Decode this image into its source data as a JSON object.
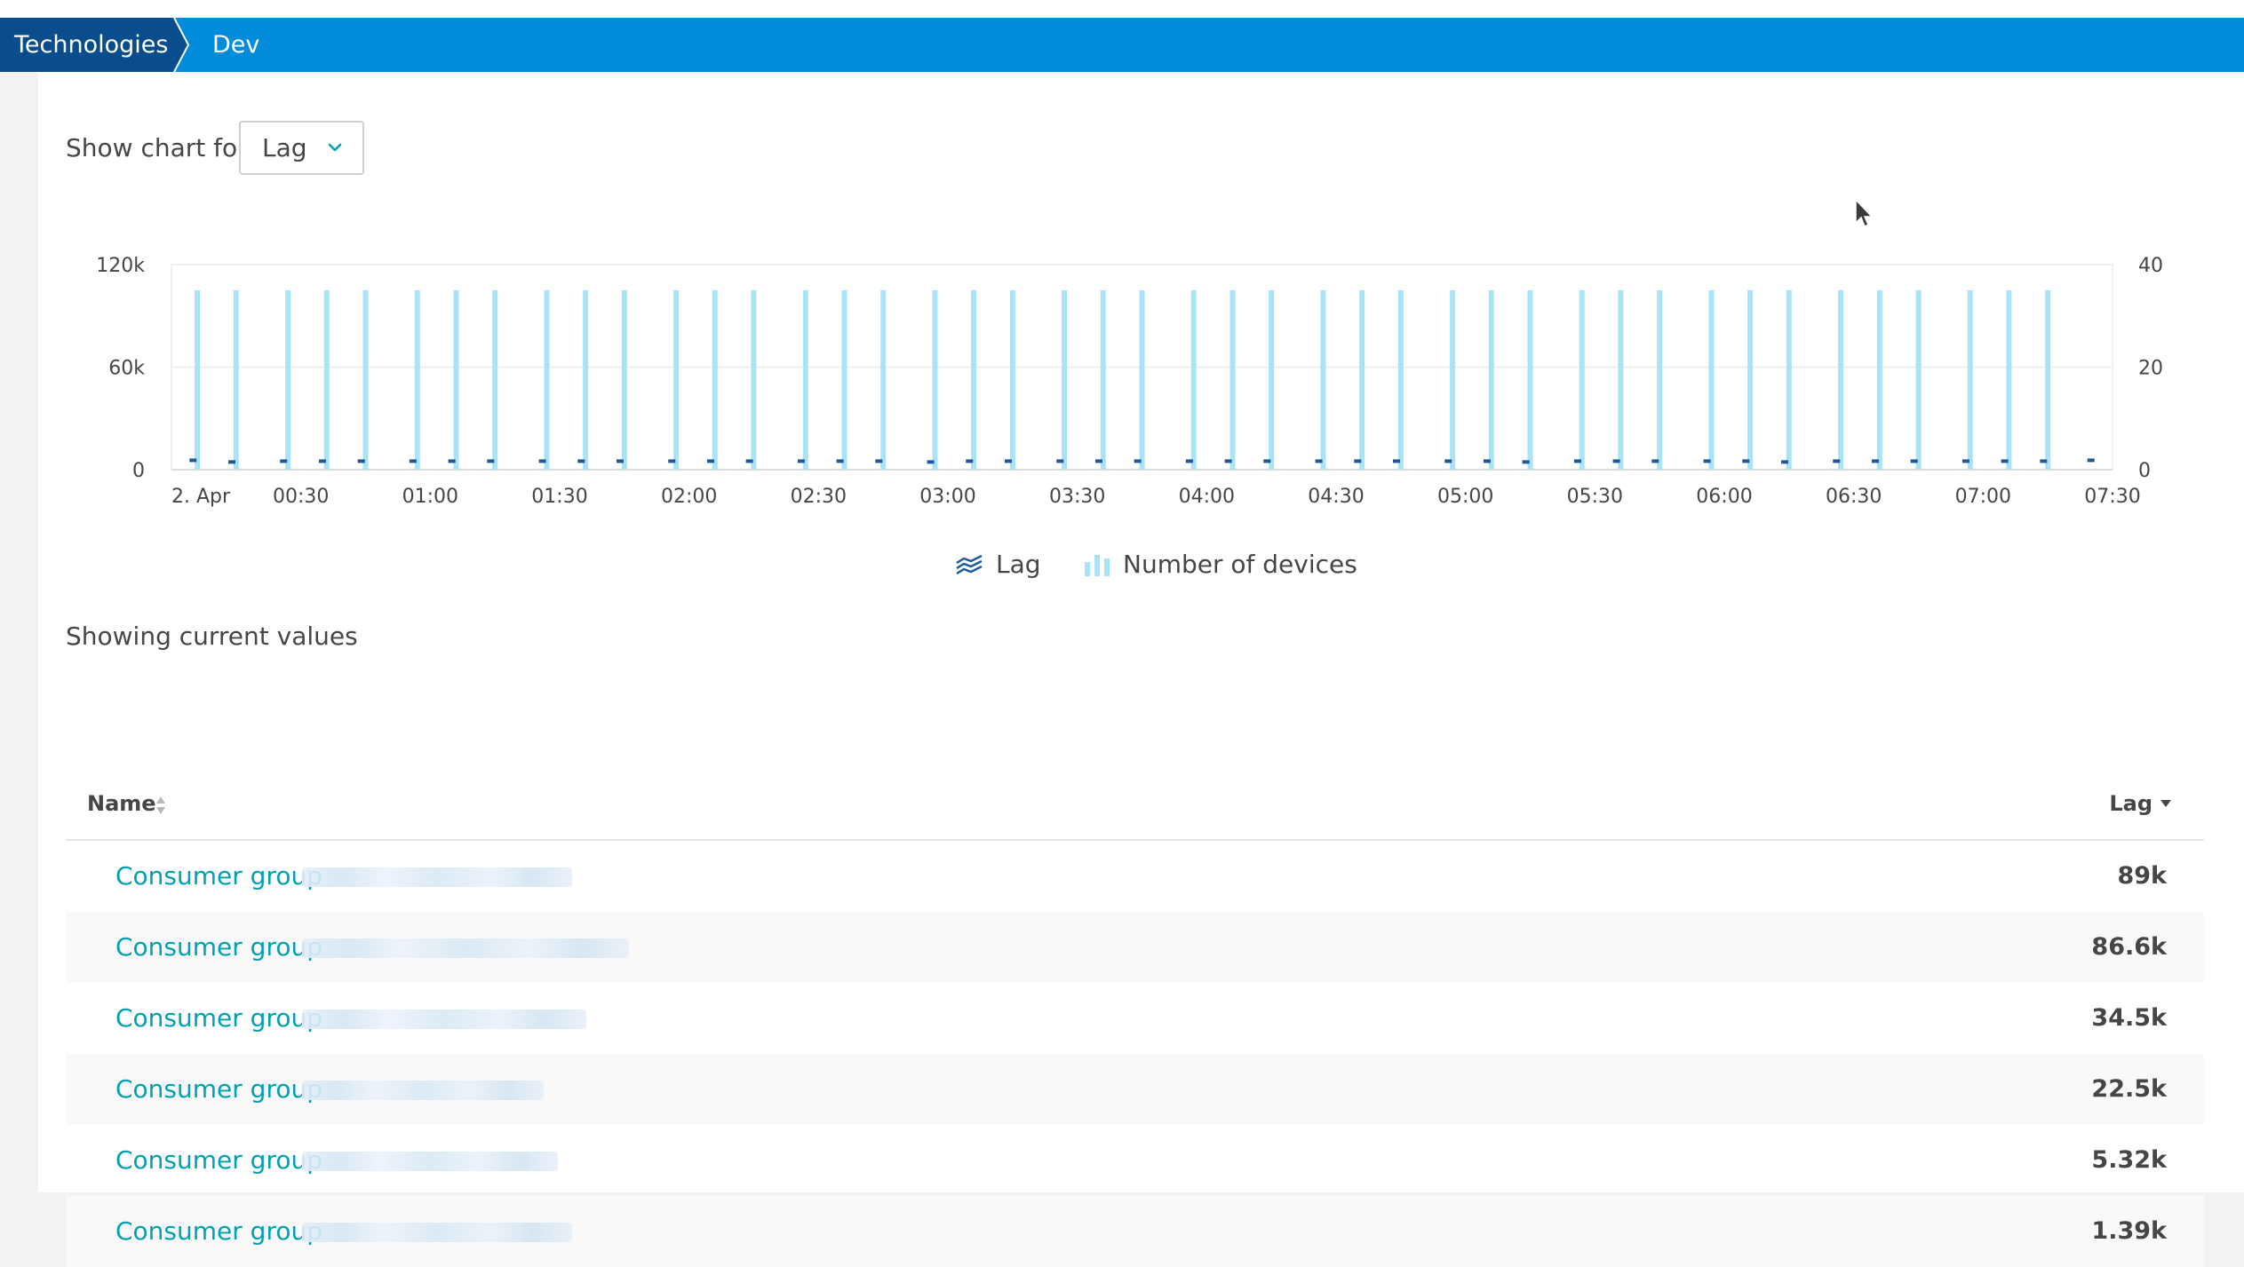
{
  "breadcrumb": {
    "items": [
      "Technologies",
      "Dev"
    ]
  },
  "colors": {
    "header": "#008cdb",
    "header_dark": "#0a4d8c",
    "link": "#00a1b2",
    "bar": "#a9e3f7",
    "lag": "#1e5a9a"
  },
  "controls": {
    "show_chart_for_label": "Show chart for",
    "metric_selected": "Lag"
  },
  "chart_data": {
    "type": "bar",
    "x_ticks": [
      "2. Apr",
      "00:30",
      "01:00",
      "01:30",
      "02:00",
      "02:30",
      "03:00",
      "03:30",
      "04:00",
      "04:30",
      "05:00",
      "05:30",
      "06:00",
      "06:30",
      "07:00",
      "07:30"
    ],
    "y_left_ticks": [
      "120k",
      "60k",
      "0"
    ],
    "y_right_ticks": [
      "40",
      "20",
      "0"
    ],
    "y_left_range": [
      0,
      120000
    ],
    "y_right_range": [
      0,
      40
    ],
    "grid": true,
    "legend_position": "bottom",
    "series": [
      {
        "name": "Number of devices",
        "axis": "right",
        "kind": "bar",
        "x_minutes": [
          6,
          15,
          27,
          36,
          45,
          57,
          66,
          75,
          87,
          96,
          105,
          117,
          126,
          135,
          147,
          156,
          165,
          177,
          186,
          195,
          207,
          216,
          225,
          237,
          246,
          255,
          267,
          276,
          285,
          297,
          306,
          315,
          327,
          336,
          345,
          357,
          366,
          375,
          387,
          396,
          405,
          417,
          426,
          435
        ],
        "values": [
          35,
          35,
          35,
          35,
          35,
          35,
          35,
          35,
          35,
          35,
          35,
          35,
          35,
          35,
          35,
          35,
          35,
          35,
          35,
          35,
          35,
          35,
          35,
          35,
          35,
          35,
          35,
          35,
          35,
          35,
          35,
          35,
          35,
          35,
          35,
          35,
          35,
          35,
          35,
          35,
          35,
          35,
          35,
          35
        ]
      },
      {
        "name": "Lag",
        "axis": "left",
        "kind": "marker",
        "x_minutes": [
          5,
          14,
          26,
          35,
          44,
          56,
          65,
          74,
          86,
          95,
          104,
          116,
          125,
          134,
          146,
          155,
          164,
          176,
          185,
          194,
          206,
          215,
          224,
          236,
          245,
          254,
          266,
          275,
          284,
          296,
          305,
          314,
          326,
          335,
          344,
          356,
          365,
          374,
          386,
          395,
          404,
          416,
          425,
          434,
          445
        ],
        "values": [
          5500,
          4500,
          5000,
          5000,
          5000,
          5000,
          5000,
          5000,
          5000,
          5000,
          5000,
          5000,
          5000,
          5000,
          5000,
          5000,
          5000,
          4500,
          5000,
          5000,
          5000,
          5000,
          5000,
          5000,
          5000,
          5000,
          5000,
          5000,
          5000,
          5000,
          5000,
          4500,
          5000,
          5000,
          5000,
          5000,
          5000,
          4500,
          5000,
          5000,
          5000,
          5000,
          5000,
          5000,
          5500
        ]
      }
    ]
  },
  "legend": {
    "lag": "Lag",
    "devices": "Number of devices"
  },
  "section": {
    "showing": "Showing current values"
  },
  "table": {
    "headers": {
      "name": "Name",
      "lag": "Lag"
    },
    "rows": [
      {
        "name": "Consumer group",
        "lag": "89k"
      },
      {
        "name": "Consumer group",
        "lag": "86.6k"
      },
      {
        "name": "Consumer group",
        "lag": "34.5k"
      },
      {
        "name": "Consumer group",
        "lag": "22.5k"
      },
      {
        "name": "Consumer group",
        "lag": "5.32k"
      },
      {
        "name": "Consumer group",
        "lag": "1.39k"
      }
    ]
  }
}
